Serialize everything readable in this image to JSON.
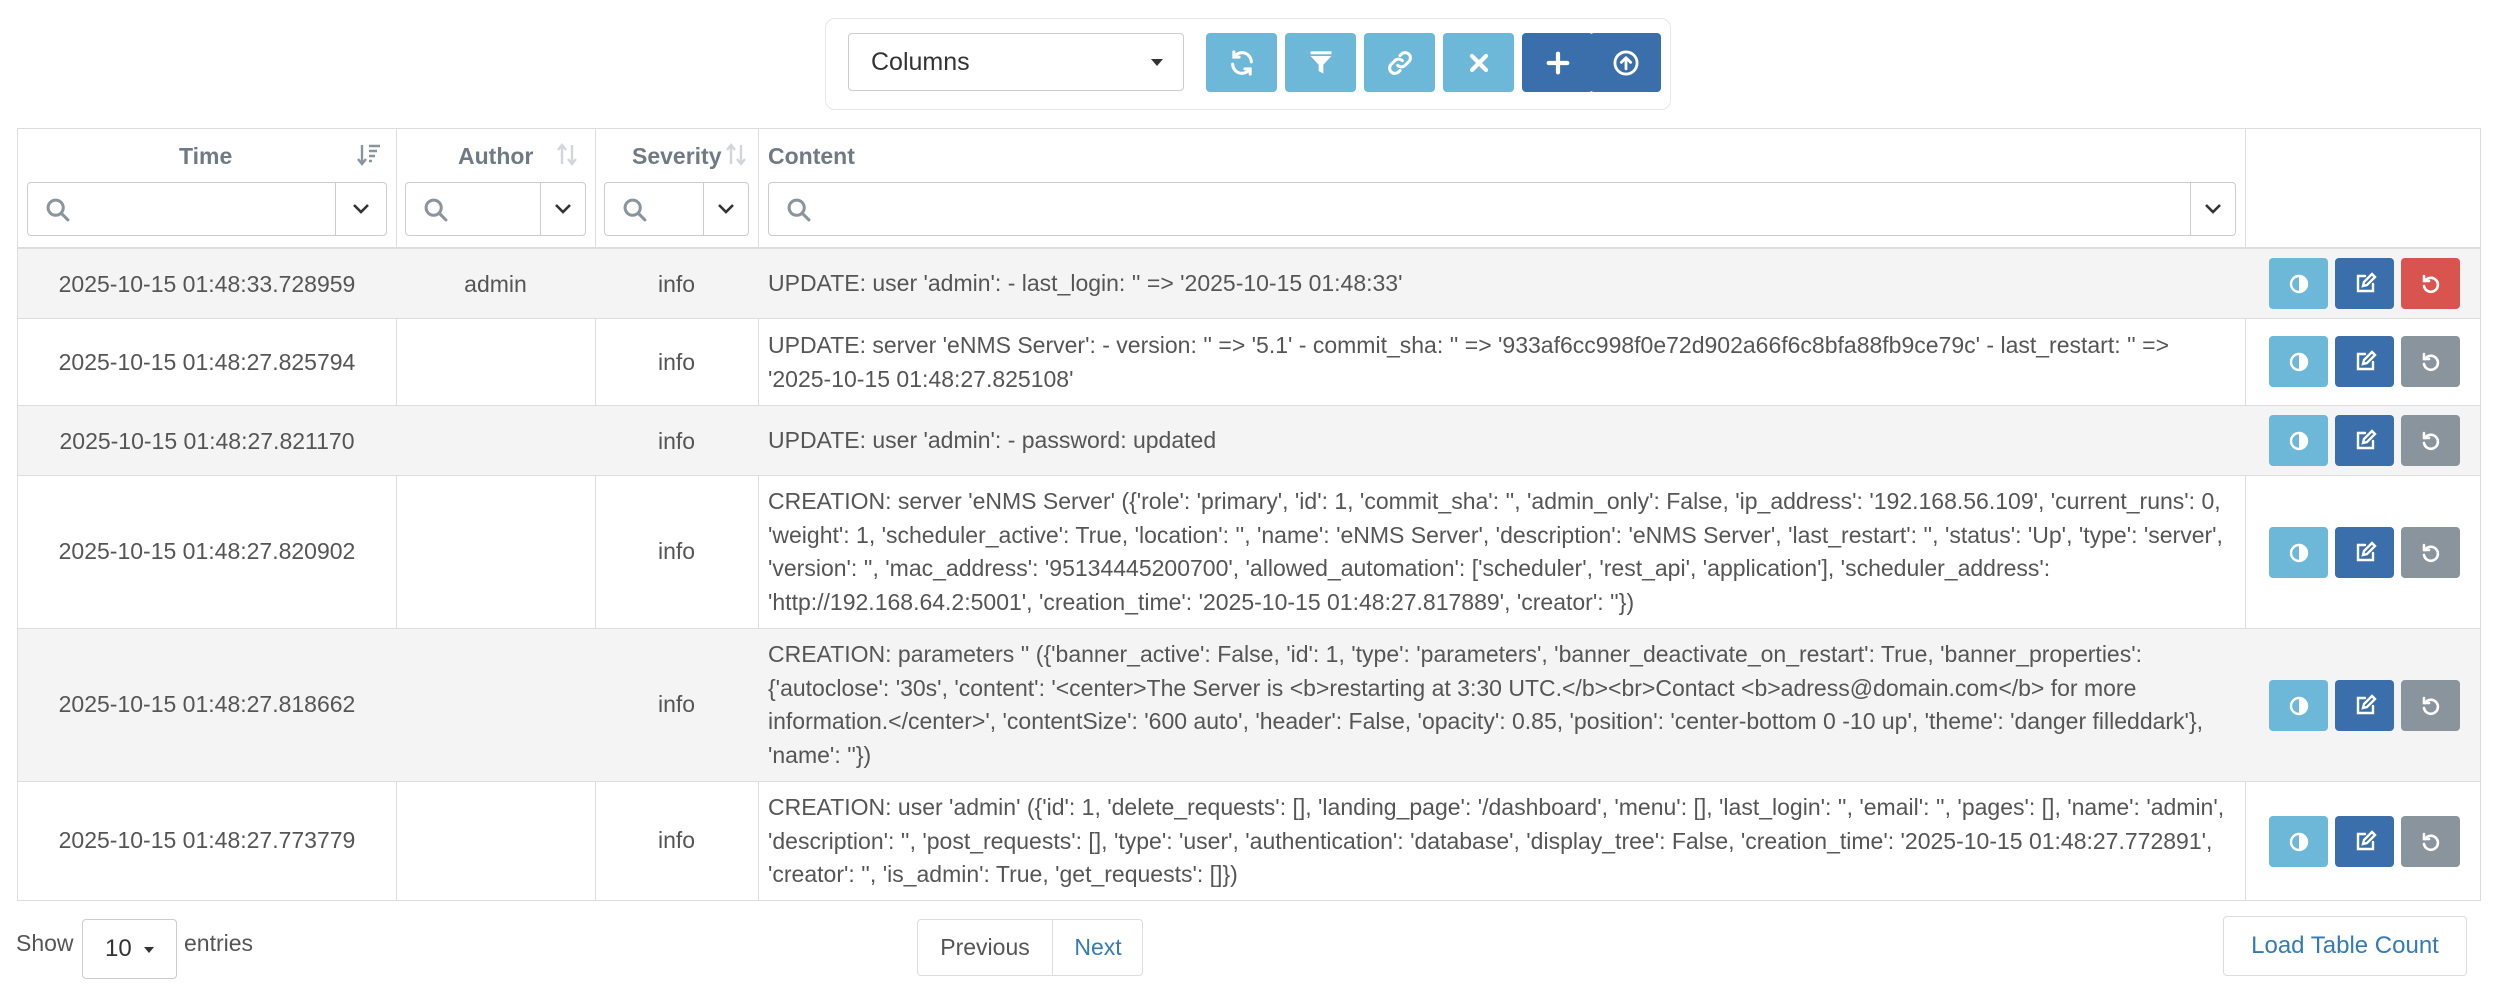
{
  "toolbar": {
    "columns_label": "Columns",
    "buttons": [
      {
        "icon": "refresh-icon",
        "color": "#6db8d8"
      },
      {
        "icon": "filter-icon",
        "color": "#6db8d8"
      },
      {
        "icon": "link-icon",
        "color": "#6db8d8"
      },
      {
        "icon": "close-icon",
        "color": "#6db8d8"
      },
      {
        "icon": "plus-icon",
        "color": "#3a6fac"
      },
      {
        "icon": "upload-icon",
        "color": "#3a6fac"
      }
    ]
  },
  "table": {
    "columns": [
      {
        "label": "Time",
        "sort": "sorted-desc"
      },
      {
        "label": "Author",
        "sort": "sortable"
      },
      {
        "label": "Severity",
        "sort": "sortable"
      },
      {
        "label": "Content",
        "sort": "none"
      }
    ],
    "rows": [
      {
        "time": "2025-10-15 01:48:33.728959",
        "author": "admin",
        "severity": "info",
        "content": "UPDATE: user 'admin': - last_login: '' => '2025-10-15 01:48:33'"
      },
      {
        "time": "2025-10-15 01:48:27.825794",
        "author": "",
        "severity": "info",
        "content": "UPDATE: server 'eNMS Server': - version: '' => '5.1' - commit_sha: '' => '933af6cc998f0e72d902a66f6c8bfa88fb9ce79c' - last_restart: '' => '2025-10-15 01:48:27.825108'"
      },
      {
        "time": "2025-10-15 01:48:27.821170",
        "author": "",
        "severity": "info",
        "content": "UPDATE: user 'admin': - password: updated"
      },
      {
        "time": "2025-10-15 01:48:27.820902",
        "author": "",
        "severity": "info",
        "content": "CREATION: server 'eNMS Server' ({'role': 'primary', 'id': 1, 'commit_sha': '', 'admin_only': False, 'ip_address': '192.168.56.109', 'current_runs': 0, 'weight': 1, 'scheduler_active': True, 'location': '', 'name': 'eNMS Server', 'description': 'eNMS Server', 'last_restart': '', 'status': 'Up', 'type': 'server', 'version': '', 'mac_address': '95134445200700', 'allowed_automation': ['scheduler', 'rest_api', 'application'], 'scheduler_address': 'http://192.168.64.2:5001', 'creation_time': '2025-10-15 01:48:27.817889', 'creator': ''})"
      },
      {
        "time": "2025-10-15 01:48:27.818662",
        "author": "",
        "severity": "info",
        "content": "CREATION: parameters '' ({'banner_active': False, 'id': 1, 'type': 'parameters', 'banner_deactivate_on_restart': True, 'banner_properties': {'autoclose': '30s', 'content': '<center>The Server is <b>restarting at 3:30 UTC.</b><br>Contact <b>adress@domain.com</b> for more information.</center>', 'contentSize': '600 auto', 'header': False, 'opacity': 0.85, 'position': 'center-bottom 0 -10 up', 'theme': 'danger filleddark'}, 'name': ''})"
      },
      {
        "time": "2025-10-15 01:48:27.773779",
        "author": "",
        "severity": "info",
        "content": "CREATION: user 'admin' ({'id': 1, 'delete_requests': [], 'landing_page': '/dashboard', 'menu': [], 'last_login': '', 'email': '', 'pages': [], 'name': 'admin', 'description': '', 'post_requests': [], 'type': 'user', 'authentication': 'database', 'display_tree': False, 'creation_time': '2025-10-15 01:48:27.772891', 'creator': '', 'is_admin': True, 'get_requests': []})"
      }
    ],
    "row_actions": [
      {
        "icon": "contrast-icon",
        "color": "#6db8d8"
      },
      {
        "icon": "edit-icon",
        "color": "#3a6fac"
      },
      {
        "icon": "revert-icon",
        "first_row_color": "#d9534f",
        "other_rows_color": "#8a949d"
      }
    ]
  },
  "footer": {
    "show_label": "Show",
    "page_length": "10",
    "entries_label": "entries",
    "previous_label": "Previous",
    "next_label": "Next",
    "load_count_label": "Load Table Count"
  }
}
